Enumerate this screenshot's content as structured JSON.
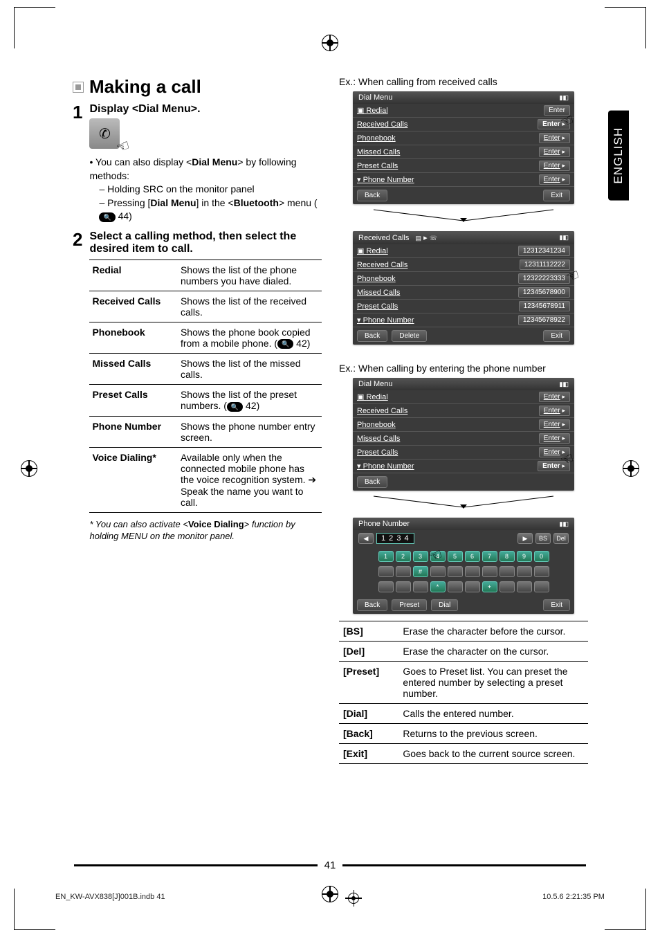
{
  "sideTab": "ENGLISH",
  "left": {
    "heading": "Making a call",
    "step1": {
      "num": "1",
      "title": "Display <Dial Menu>.",
      "bullet": "You can also display <",
      "bulletBold": "Dial Menu",
      "bulletTail": "> by following methods:",
      "sub1": "Holding SRC on the monitor panel",
      "sub2a": "Pressing [",
      "sub2b": "Dial Menu",
      "sub2c": "] in the <",
      "sub2d": "Bluetooth",
      "sub2e": "> menu (",
      "sub2f": " 44)"
    },
    "step2": {
      "num": "2",
      "title": "Select a calling method, then select the desired item to call."
    },
    "defs": [
      {
        "term": "Redial",
        "desc": "Shows the list of the phone numbers you have dialed."
      },
      {
        "term": "Received Calls",
        "desc": "Shows the list of the received calls."
      },
      {
        "term": "Phonebook",
        "descA": "Shows the phone book copied from a mobile phone. (",
        "descB": " 42)"
      },
      {
        "term": "Missed Calls",
        "desc": "Shows the list of the missed calls."
      },
      {
        "term": "Preset Calls",
        "descA": "Shows the list of the preset numbers. (",
        "descB": " 42)"
      },
      {
        "term": "Phone Number",
        "desc": "Shows the phone number entry screen."
      },
      {
        "term": "Voice Dialing*",
        "desc": "Available only when the connected mobile phone has the voice recognition system. ➔ Speak the name you want to call."
      }
    ],
    "footnoteA": "* You can also activate <",
    "footnoteB": "Voice Dialing",
    "footnoteC": "> function by holding MENU on the monitor panel."
  },
  "right": {
    "cap1": "Ex.: When calling from received calls",
    "cap2": "Ex.: When calling by entering the phone number",
    "screen1": {
      "title": "Dial Menu",
      "rows": [
        "Redial",
        "Received Calls",
        "Phonebook",
        "Missed Calls",
        "Preset Calls",
        "Phone Number"
      ],
      "btn": "Enter",
      "back": "Back",
      "exit": "Exit"
    },
    "screen2": {
      "title": "Received Calls",
      "rows": [
        "Redial",
        "Received Calls",
        "Phonebook",
        "Missed Calls",
        "Preset Calls",
        "Phone Number"
      ],
      "vals": [
        "12312341234",
        "12311112222",
        "12322223333",
        "12345678900",
        "12345678911",
        "12345678922"
      ],
      "back": "Back",
      "delete": "Delete",
      "exit": "Exit"
    },
    "screen3": {
      "title": "Dial Menu",
      "rows": [
        "Redial",
        "Received Calls",
        "Phonebook",
        "Missed Calls",
        "Preset Calls",
        "Phone Number"
      ],
      "btn": "Enter",
      "back": "Back"
    },
    "screen4": {
      "title": "Phone Number",
      "entry": "1 2 3 4",
      "bs": "BS",
      "del": "Del",
      "back": "Back",
      "preset": "Preset",
      "dial": "Dial",
      "exit": "Exit"
    },
    "keytable": [
      {
        "k": "[BS]",
        "d": "Erase the character before the cursor."
      },
      {
        "k": "[Del]",
        "d": "Erase the character on the cursor."
      },
      {
        "k": "[Preset]",
        "d": "Goes to Preset list. You can preset the entered number by selecting a preset number."
      },
      {
        "k": "[Dial]",
        "d": "Calls the entered number."
      },
      {
        "k": "[Back]",
        "d": "Returns to the previous screen."
      },
      {
        "k": "[Exit]",
        "d": "Goes back to the current source screen."
      }
    ]
  },
  "pageNum": "41",
  "footer": {
    "left": "EN_KW-AVX838[J]001B.indb   41",
    "right": "10.5.6   2:21:35 PM"
  }
}
